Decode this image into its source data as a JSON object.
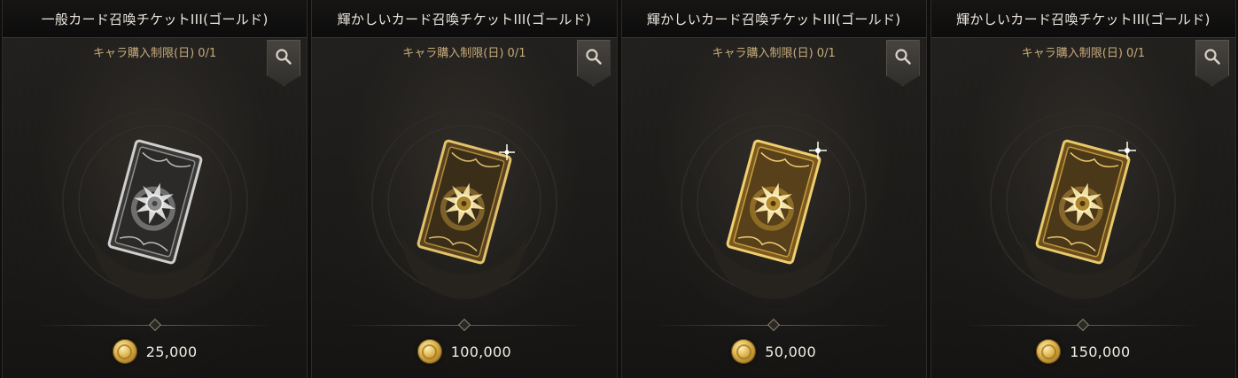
{
  "cards": [
    {
      "title": "一般カード召喚チケットIII(ゴールド)",
      "limit": "キャラ購入制限(日) 0/1",
      "price": "25,000",
      "icon": "silver-card-icon",
      "tone": "silver"
    },
    {
      "title": "輝かしいカード召喚チケットIII(ゴールド)",
      "limit": "キャラ購入制限(日) 0/1",
      "price": "100,000",
      "icon": "gold-card-icon",
      "tone": "gold"
    },
    {
      "title": "輝かしいカード召喚チケットIII(ゴールド)",
      "limit": "キャラ購入制限(日) 0/1",
      "price": "50,000",
      "icon": "gold-card-icon",
      "tone": "gold"
    },
    {
      "title": "輝かしいカード召喚チケットIII(ゴールド)",
      "limit": "キャラ購入制限(日) 0/1",
      "price": "150,000",
      "icon": "gold-card-icon",
      "tone": "gold"
    }
  ],
  "icons": {
    "zoom": "magnifier-icon",
    "currency": "gold-coin-icon"
  },
  "colors": {
    "title": "#ebe7df",
    "limit": "#c6ab7a",
    "price": "#f1ece3",
    "gold": "#d9b454",
    "silver": "#c9c9c9"
  }
}
